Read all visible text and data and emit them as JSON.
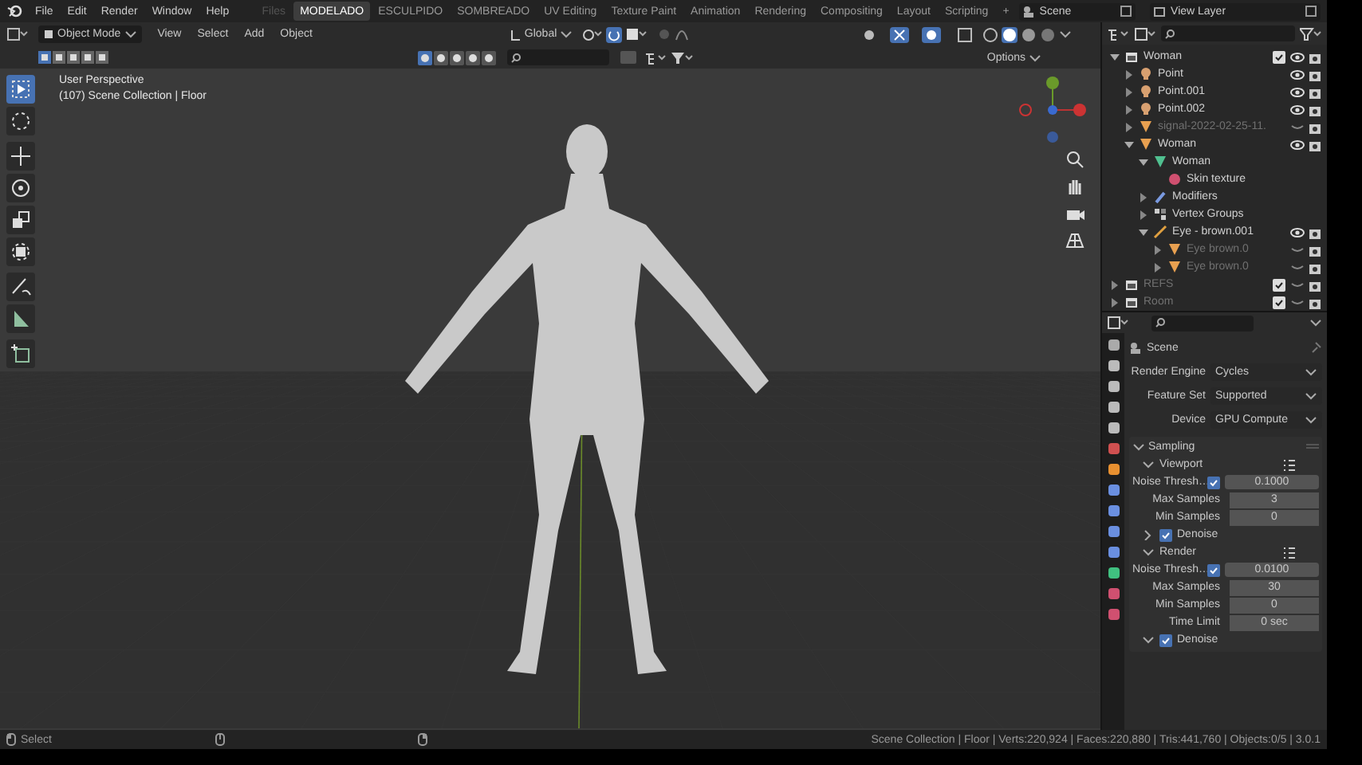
{
  "menu": [
    "File",
    "Edit",
    "Render",
    "Window",
    "Help"
  ],
  "workspaces": [
    {
      "label": "Files",
      "selected": false,
      "disabled": true
    },
    {
      "label": "MODELADO",
      "selected": true,
      "disabled": false
    },
    {
      "label": "ESCULPIDO",
      "selected": false,
      "disabled": false
    },
    {
      "label": "SOMBREADO",
      "selected": false,
      "disabled": false
    },
    {
      "label": "UV Editing",
      "selected": false,
      "disabled": false
    },
    {
      "label": "Texture Paint",
      "selected": false,
      "disabled": false
    },
    {
      "label": "Animation",
      "selected": false,
      "disabled": false
    },
    {
      "label": "Rendering",
      "selected": false,
      "disabled": false
    },
    {
      "label": "Compositing",
      "selected": false,
      "disabled": false
    },
    {
      "label": "Layout",
      "selected": false,
      "disabled": false
    },
    {
      "label": "Scripting",
      "selected": false,
      "disabled": false
    },
    {
      "label": "+",
      "selected": false,
      "disabled": false
    }
  ],
  "scene": "Scene",
  "view_layer": "View Layer",
  "viewport_header": {
    "mode": "Object Mode",
    "menus": [
      "View",
      "Select",
      "Add",
      "Object"
    ],
    "orientation": "Global",
    "options": "Options"
  },
  "overlay": {
    "view_name": "User Perspective",
    "context": "(107) Scene Collection | Floor"
  },
  "tools": [
    {
      "selected": true
    },
    {
      "selected": false
    },
    {
      "selected": false
    },
    {
      "selected": false
    },
    {
      "selected": false
    },
    {
      "selected": false
    },
    {
      "selected": false
    },
    {
      "selected": false
    },
    {
      "selected": false
    }
  ],
  "outliner": {
    "items": [
      {
        "kind": "collection",
        "label": "Woman",
        "expanded": true,
        "checked": true,
        "visible": true,
        "children": [
          {
            "kind": "light",
            "label": "Point",
            "expanded": false,
            "visible": true
          },
          {
            "kind": "light",
            "label": "Point.001",
            "expanded": false,
            "visible": true
          },
          {
            "kind": "light",
            "label": "Point.002",
            "expanded": false,
            "visible": true
          },
          {
            "kind": "mesh-object",
            "label": "signal-2022-02-25-11.",
            "expanded": false,
            "visible": false
          },
          {
            "kind": "mesh-object",
            "label": "Woman",
            "expanded": true,
            "visible": true,
            "children": [
              {
                "kind": "mesh-data",
                "label": "Woman",
                "expanded": true,
                "children": [
                  {
                    "kind": "material",
                    "label": "Skin texture"
                  }
                ]
              },
              {
                "kind": "modifiers",
                "label": "Modifiers",
                "expanded": false
              },
              {
                "kind": "vertex-groups",
                "label": "Vertex Groups",
                "expanded": false
              },
              {
                "kind": "armature",
                "label": "Eye - brown.001",
                "expanded": true,
                "visible": true,
                "children": [
                  {
                    "kind": "mesh-object",
                    "label": "Eye brown.0",
                    "expanded": false,
                    "visible": false
                  },
                  {
                    "kind": "mesh-object",
                    "label": "Eye brown.0",
                    "expanded": false,
                    "visible": false
                  }
                ]
              }
            ]
          }
        ]
      },
      {
        "kind": "collection",
        "label": "REFS",
        "expanded": false,
        "checked": true,
        "visible": false
      },
      {
        "kind": "collection",
        "label": "Room",
        "expanded": false,
        "checked": true,
        "visible": false
      }
    ]
  },
  "properties": {
    "context": "Scene",
    "fields": [
      {
        "label": "Render Engine",
        "value": "Cycles"
      },
      {
        "label": "Feature Set",
        "value": "Supported"
      },
      {
        "label": "Device",
        "value": "GPU Compute"
      }
    ],
    "sampling": {
      "title": "Sampling",
      "expanded": true,
      "rows": [
        {
          "kind": "subpanel",
          "label": "Viewport",
          "expanded": true
        },
        {
          "kind": "threshold",
          "label": "Noise Thresh…",
          "checked": true,
          "value": "0.1000"
        },
        {
          "kind": "number",
          "label": "Max Samples",
          "value": "3"
        },
        {
          "kind": "number",
          "label": "Min Samples",
          "value": "0"
        },
        {
          "kind": "toggle-panel",
          "label": "Denoise",
          "checked": true,
          "expanded": false
        },
        {
          "kind": "subpanel",
          "label": "Render",
          "expanded": true
        },
        {
          "kind": "threshold",
          "label": "Noise Thresh…",
          "checked": true,
          "value": "0.0100"
        },
        {
          "kind": "number",
          "label": "Max Samples",
          "value": "30"
        },
        {
          "kind": "number",
          "label": "Min Samples",
          "value": "0"
        },
        {
          "kind": "number",
          "label": "Time Limit",
          "value": "0 sec"
        },
        {
          "kind": "toggle-panel",
          "label": "Denoise",
          "checked": true,
          "expanded": true
        }
      ]
    }
  },
  "status_bar": {
    "left": "Select",
    "right": "Scene Collection | Floor | Verts:220,924 | Faces:220,880 | Tris:441,760 | Objects:0/5 | 3.0.1"
  }
}
